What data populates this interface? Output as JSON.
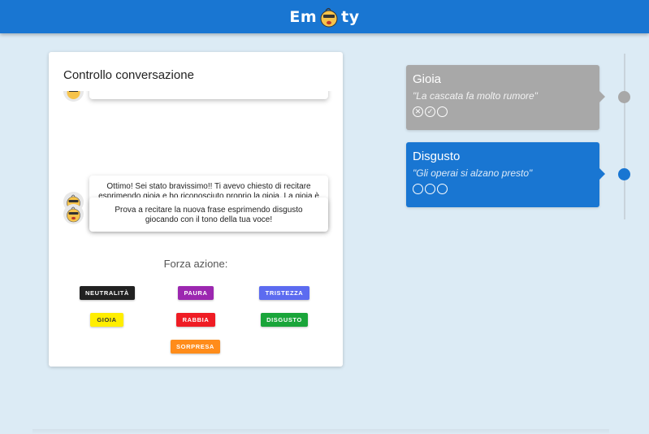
{
  "header": {
    "logo_text_left": "Em",
    "logo_text_right": "ty",
    "logo_icon": "baby-face-icon",
    "bar_color": "#1976d2"
  },
  "panel": {
    "title": "Controllo conversazione",
    "messages": [
      {
        "text": "Ottimo! Sei stato bravissimo!! Ti avevo chiesto di recitare esprimendo gioia e ho riconosciuto proprio la gioia. La gioia è l'emozione che provi per esempio quando prendi un bel voto a scuola."
      },
      {
        "text": "Prova a recitare la nuova frase esprimendo disgusto giocando con il tono della tua voce!"
      }
    ],
    "force_label": "Forza azione:",
    "actions": [
      {
        "label": "NEUTRALITÀ",
        "color": "#212121"
      },
      {
        "label": "PAURA",
        "color": "#9c27b0"
      },
      {
        "label": "TRISTEZZA",
        "color": "#5c6bf0"
      },
      {
        "label": "GIOIA",
        "color": "#ffee00"
      },
      {
        "label": "RABBIA",
        "color": "#ef1c24"
      },
      {
        "label": "DISGUSTO",
        "color": "#1aa53a"
      },
      {
        "label": "SORPRESA",
        "color": "#ff8c1a"
      }
    ]
  },
  "timeline": [
    {
      "emotion": "Gioia",
      "phrase": "\"La cascata fa molto rumore\"",
      "state": "done",
      "color": "#a8a8a8",
      "icons": [
        "x-circle-icon",
        "check-circle-icon",
        "empty-circle-icon"
      ]
    },
    {
      "emotion": "Disgusto",
      "phrase": "\"Gli operai si alzano presto\"",
      "state": "current",
      "color": "#1976d2",
      "icons": [
        "empty-circle-icon",
        "empty-circle-icon",
        "empty-circle-icon"
      ]
    }
  ]
}
